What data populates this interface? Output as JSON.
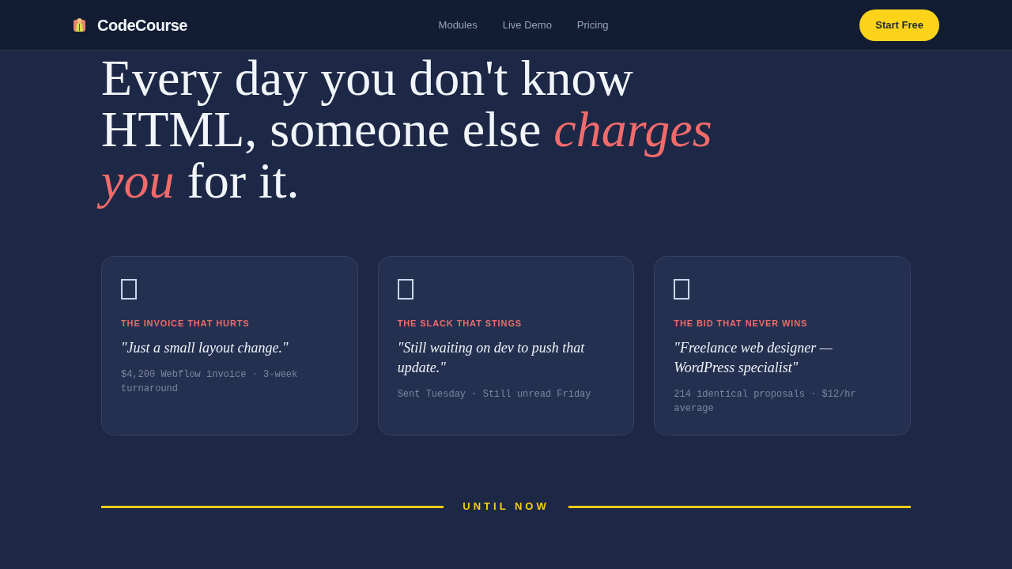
{
  "header": {
    "logo_text": "CodeCourse",
    "nav": [
      {
        "label": "Modules"
      },
      {
        "label": "Live Demo"
      },
      {
        "label": "Pricing"
      }
    ],
    "cta": "Start Free"
  },
  "hero": {
    "headline": "Every day you don't know HTML, someone else *charges you* for it."
  },
  "cards": [
    {
      "label": "THE INVOICE THAT HURTS",
      "quote": "\"Just a small layout change.\"",
      "meta": "$4,200 Webflow invoice · 3-week turnaround"
    },
    {
      "label": "THE SLACK THAT STINGS",
      "quote": "\"Still waiting on dev to push that update.\"",
      "meta": "Sent Tuesday · Still unread Friday"
    },
    {
      "label": "THE BID THAT NEVER WINS",
      "quote": "\"Freelance web designer — WordPress specialist\"",
      "meta": "214 identical proposals · $12/hr average"
    }
  ],
  "divider": {
    "label": "UNTIL NOW"
  }
}
